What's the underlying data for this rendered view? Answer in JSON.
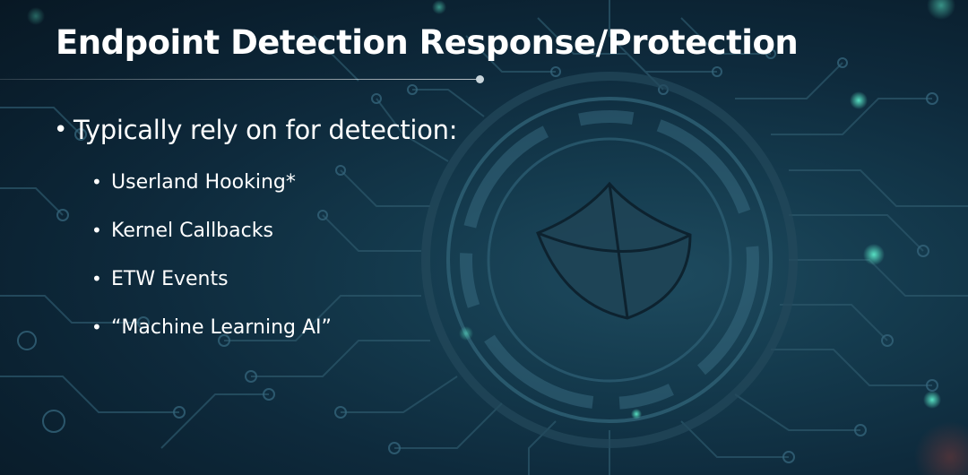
{
  "slide": {
    "title": "Endpoint Detection Response/Protection",
    "bullets": [
      {
        "text": "Typically rely on for detection:",
        "sub": [
          "Userland Hooking*",
          "Kernel Callbacks",
          "ETW Events",
          "“Machine Learning AI”"
        ]
      }
    ],
    "bullet_glyph": "•"
  },
  "background": {
    "icon": "shield-icon",
    "colors": {
      "base": "#0b2233",
      "circuit": "#2c5a6e",
      "accent_glow": "#3fd1b0"
    }
  }
}
